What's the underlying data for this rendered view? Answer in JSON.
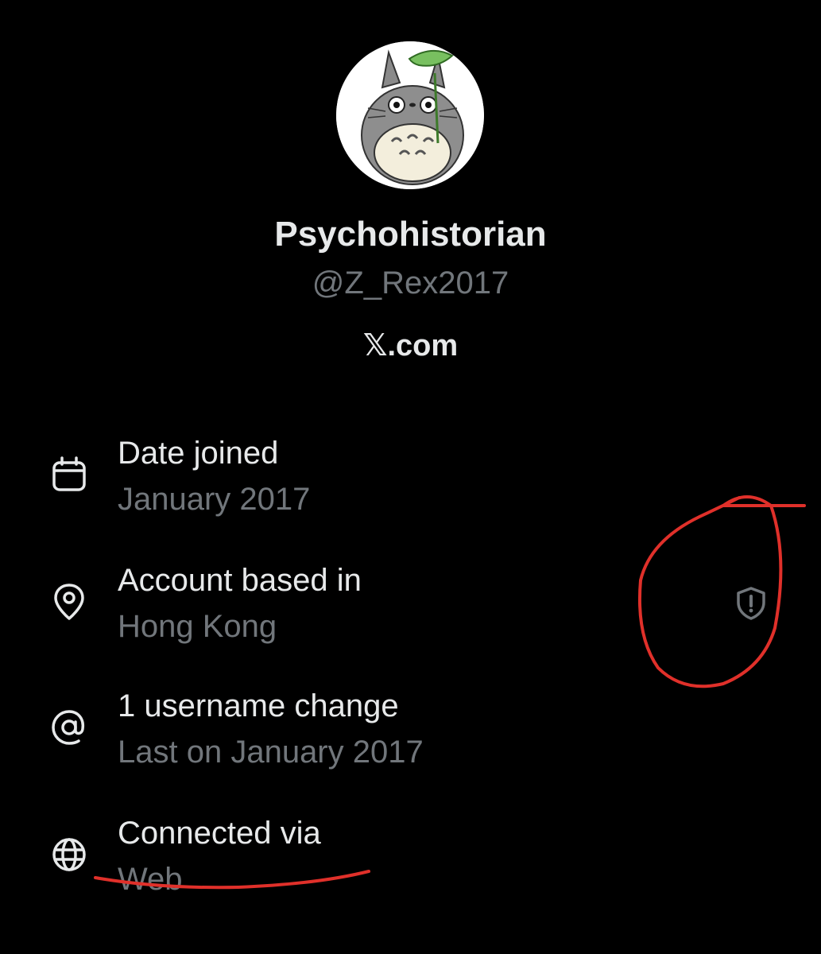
{
  "profile": {
    "display_name": "Psychohistorian",
    "handle": "@Z_Rex2017",
    "site": "𝕏.com",
    "avatar_icon": "totoro-avatar"
  },
  "details": [
    {
      "icon": "calendar-icon",
      "title": "Date joined",
      "value": "January 2017"
    },
    {
      "icon": "location-pin-icon",
      "title": "Account based in",
      "value": "Hong Kong"
    },
    {
      "icon": "at-sign-icon",
      "title": "1 username change",
      "value": "Last on January 2017"
    },
    {
      "icon": "globe-icon",
      "title": "Connected via",
      "value": "Web"
    }
  ],
  "indicator": {
    "icon": "shield-alert-icon"
  },
  "colors": {
    "background": "#000000",
    "primary_text": "#e7e9ea",
    "secondary_text": "#71767b",
    "annotation": "#e0302a"
  }
}
